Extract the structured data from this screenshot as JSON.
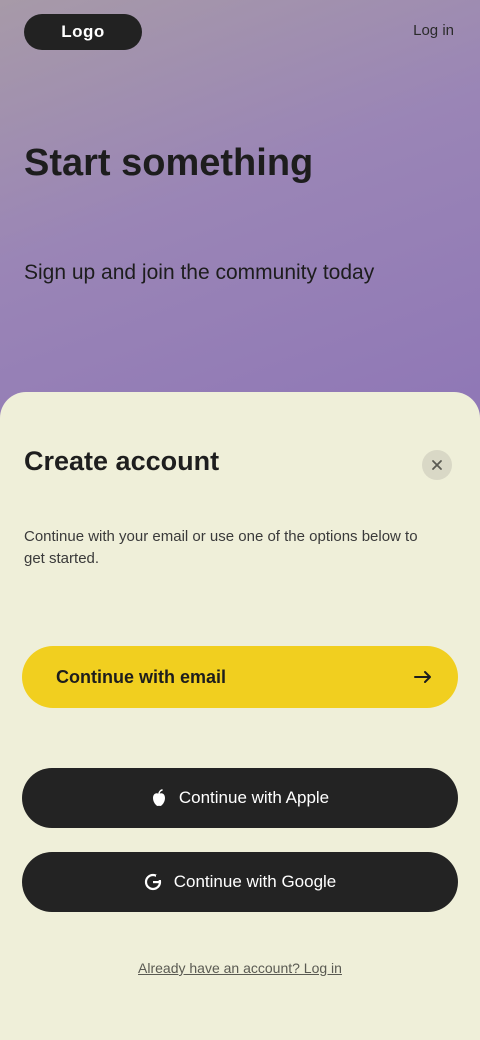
{
  "header": {
    "logo_text": "Logo",
    "link_label": "Log in"
  },
  "hero": {
    "headline": "Start something",
    "subhead": "Sign up and join the community today"
  },
  "sheet": {
    "title": "Create account",
    "description": "Continue with your email or use one of the options below to get started.",
    "primary_button": "Continue with email",
    "apple_button": "Continue with Apple",
    "google_button": "Continue with Google",
    "footer_link": "Already have an account? Log in"
  },
  "colors": {
    "hero_top": "#a79aa8",
    "hero_bottom": "#8f77b6",
    "sheet_bg": "#efefd9",
    "primary": "#f1cf1f",
    "dark_button": "#232323"
  },
  "icons": {
    "close": "close-icon",
    "arrow": "arrow-right-icon",
    "apple": "apple-icon",
    "google": "google-icon"
  }
}
